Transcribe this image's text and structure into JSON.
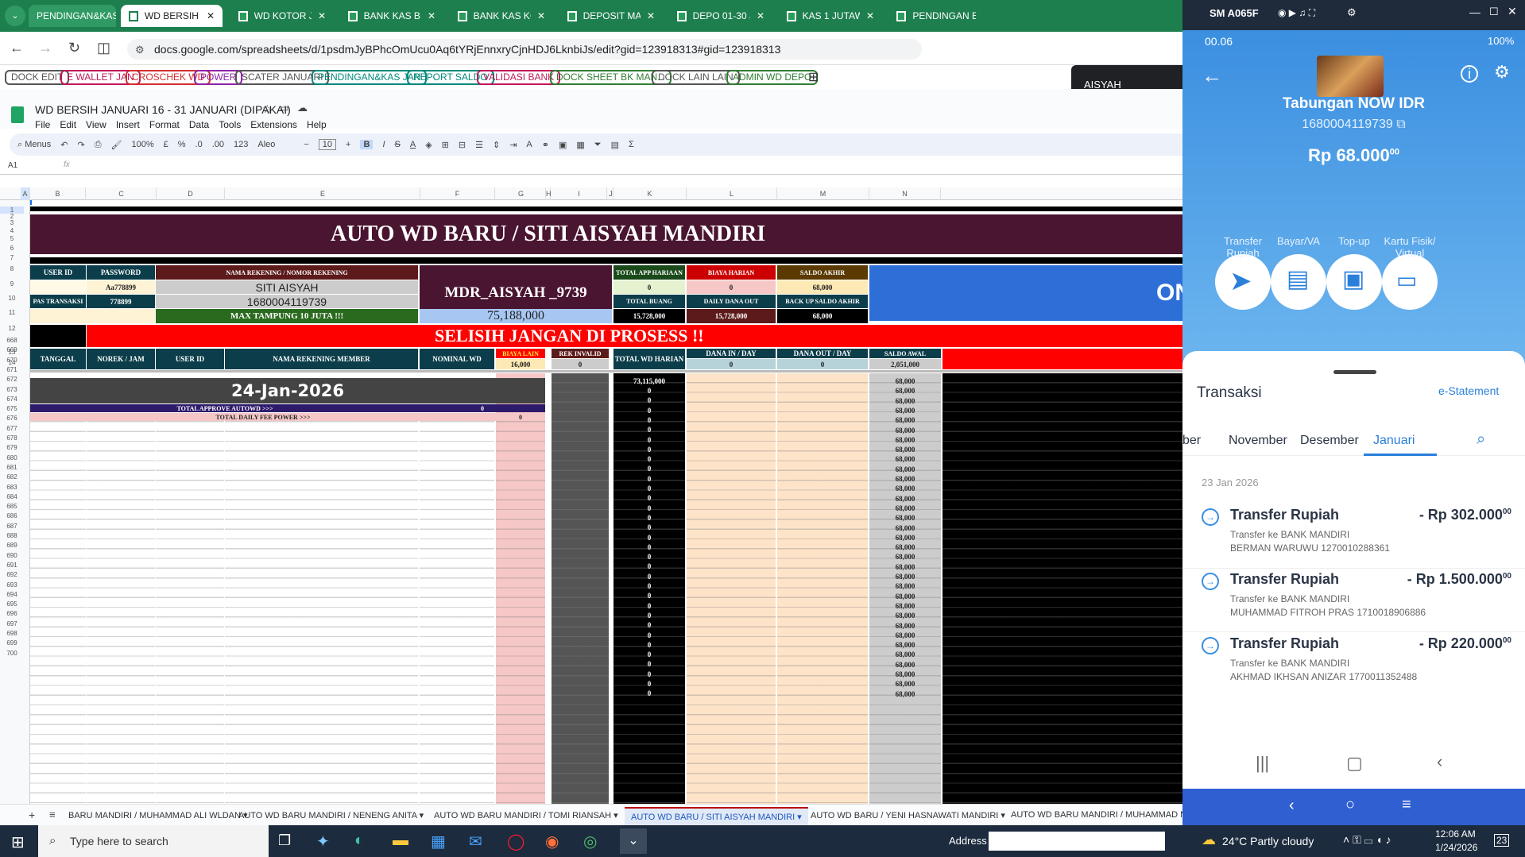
{
  "browser": {
    "tabs": [
      {
        "label": "PENDINGAN&KAS JA"
      },
      {
        "label": "WD BERSIH JANUA"
      },
      {
        "label": "WD KOTOR JANUA"
      },
      {
        "label": "BANK KAS BERSIH"
      },
      {
        "label": "BANK KAS KOTOR"
      },
      {
        "label": "DEPOSIT MANUAL"
      },
      {
        "label": "DEPO 01-30 JANU"
      },
      {
        "label": "KAS 1 JUTAWAN J"
      },
      {
        "label": "PENDINGAN EWA"
      }
    ],
    "url": "docs.google.com/spreadsheets/d/1psdmJyBPhcOmUcu0Aq6tYRjEnnxryCjnHDJ6LknbiJs/edit?gid=123918313#gid=123918313",
    "bookmarks": [
      {
        "label": "DOCK EDIT",
        "color": "#555"
      },
      {
        "label": "E WALLET JAN",
        "color": "#c2185b"
      },
      {
        "label": "CROSCHEK WD",
        "color": "#d32f2f"
      },
      {
        "label": "POWER",
        "color": "#8e24aa"
      },
      {
        "label": "SCATER JANUARI",
        "color": "#555"
      },
      {
        "label": "PENDINGAN&KAS JAN",
        "color": "#00897b"
      },
      {
        "label": "REPORT SALDO",
        "color": "#00897b"
      },
      {
        "label": "VALIDASI BANK",
        "color": "#c2185b"
      },
      {
        "label": "DOCK SHEET BK MAN...",
        "color": "#2e7d32"
      },
      {
        "label": "DOCK LAIN LAIN",
        "color": "#555"
      },
      {
        "label": "ADMIN WD DEPO",
        "color": "#2e7d32"
      }
    ],
    "popup_label": "AISYAH"
  },
  "sheet": {
    "title": "WD BERSIH JANUARI 16 - 31 JANUARI (DIPAKAI)",
    "menu": [
      "File",
      "Edit",
      "View",
      "Insert",
      "Format",
      "Data",
      "Tools",
      "Extensions",
      "Help"
    ],
    "toolbar": {
      "menus": "Menus",
      "zoom": "100%",
      "currency": "£",
      "percent": "%",
      "dec_minus": ".0",
      "dec_plus": ".00",
      "num": "123",
      "font": "Aleo",
      "font_size": "10"
    },
    "cell_ref": "A1",
    "fx": "fx",
    "columns": [
      "A",
      "B",
      "C",
      "D",
      "E",
      "F",
      "G",
      "H",
      "I",
      "J",
      "K",
      "L",
      "M",
      "N"
    ],
    "rows_top": [
      "1",
      "2",
      "3",
      "4",
      "5",
      "6",
      "7",
      "8",
      "9",
      "10",
      "11",
      "12",
      "13",
      "14"
    ],
    "rows_body": [
      "668",
      "669",
      "670",
      "671",
      "672",
      "673",
      "674",
      "675",
      "676",
      "677",
      "678",
      "679",
      "680",
      "681",
      "682",
      "683",
      "684",
      "685",
      "686",
      "687",
      "688",
      "689",
      "690",
      "691",
      "692",
      "693",
      "694",
      "695",
      "696",
      "697",
      "698",
      "699",
      "700"
    ],
    "banner": "AUTO WD BARU / SITI AISYAH MANDIRI",
    "hdr": {
      "user_id": "USER ID",
      "password": "PASSWORD",
      "nama_rek": "NAMA REKENING / NOMOR REKENING",
      "pas_transaksi": "PAS TRANSAKSI",
      "password_val": "Aa778899",
      "pas_val": "778899",
      "nama": "SITI AISYAH",
      "norek": "1680004119739",
      "max": "MAX TAMPUNG 10 JUTA !!!",
      "mdr": "MDR_AISYAH _9739",
      "mdr_total": "75,188,000",
      "total_app": "TOTAL APP HARIAAN",
      "biaya": "BIAYA HARIAN",
      "saldo_akhir": "SALDO AKHIR",
      "total_app_val": "0",
      "biaya_val": "0",
      "saldo_akhir_val": "68,000",
      "total_buang": "TOTAL BUANG",
      "daily_out": "DAILY DANA OUT",
      "backup": "BACK UP SALDO AKHIR",
      "total_buang_val": "15,728,000",
      "daily_out_val": "15,728,000",
      "backup_val": "68,000",
      "on": "ON",
      "selisih": "SELISIH JANGAN DI PROSESS !!",
      "tanggal": "TANGGAL",
      "norek_jam": "NOREK / JAM",
      "user_id2": "USER ID",
      "nama_member": "NAMA REKENING MEMBER",
      "nominal": "NOMINAL WD",
      "biaya_lain": "BIAYA LAIN",
      "biaya_lain_val": "16,000",
      "rek_invalid": "REK INVALID",
      "rek_invalid_val": "0",
      "total_wd": "TOTAL WD HARIAN",
      "dana_in": "DANA IN / DAY",
      "dana_in_val": "0",
      "dana_out": "DANA OUT / DAY",
      "dana_out_val": "0",
      "saldo_awal": "SALDO AWAL",
      "saldo_awal_val": "2,051,000"
    },
    "date_header": "24-Jan-2026",
    "total_approve": "TOTAL APPROVE AUTOWD >>>",
    "total_approve_val": "0",
    "total_fee": "TOTAL DAILY FEE POWER >>>",
    "total_fee_val": "0",
    "total_wd_first": "73,115,000",
    "k_values": [
      "0",
      "0",
      "0",
      "0",
      "0",
      "0",
      "0",
      "0",
      "0",
      "0",
      "0",
      "0",
      "0",
      "0",
      "0",
      "0",
      "0",
      "0",
      "0",
      "0",
      "0",
      "0",
      "0",
      "0",
      "0",
      "0",
      "0",
      "0",
      "0",
      "0",
      "0",
      "0"
    ],
    "n_values": [
      "68,000",
      "68,000",
      "68,000",
      "68,000",
      "68,000",
      "68,000",
      "68,000",
      "68,000",
      "68,000",
      "68,000",
      "68,000",
      "68,000",
      "68,000",
      "68,000",
      "68,000",
      "68,000",
      "68,000",
      "68,000",
      "68,000",
      "68,000",
      "68,000",
      "68,000",
      "68,000",
      "68,000",
      "68,000",
      "68,000",
      "68,000",
      "68,000",
      "68,000",
      "68,000",
      "68,000",
      "68,000",
      "68,000"
    ],
    "tabs": [
      "BARU MANDIRI / MUHAMMAD ALI WLDAN",
      "AUTO WD BARU MANDIRI / NENENG ANITA",
      "AUTO WD BARU MANDIRI / TOMI RIANSAH",
      "AUTO WD BARU / SITI AISYAH MANDIRI",
      "AUTO WD BARU / YENI HASNAWATI MANDIRI",
      "AUTO WD BARU MANDIRI / MUHAMMAD NURD"
    ]
  },
  "phone": {
    "device": "SM A065F",
    "time": "00.06",
    "battery": "100%",
    "account_name": "Tabungan NOW IDR",
    "account_no": "1680004119739",
    "balance": "Rp 68.000",
    "balance_sup": "00",
    "actions": [
      {
        "l1": "Transfer",
        "l2": "Rupiah"
      },
      {
        "l1": "Bayar/VA",
        "l2": ""
      },
      {
        "l1": "Top-up",
        "l2": ""
      },
      {
        "l1": "Kartu Fisik/",
        "l2": "Virtual"
      }
    ],
    "transaksi": "Transaksi",
    "estatement": "e-Statement",
    "months": [
      "ber",
      "November",
      "Desember",
      "Januari"
    ],
    "date": "23 Jan 2026",
    "transactions": [
      {
        "title": "Transfer Rupiah",
        "amount": "- Rp 302.000",
        "sup": "00",
        "l1": "Transfer ke BANK MANDIRI",
        "l2": "BERMAN WARUWU 1270010288361"
      },
      {
        "title": "Transfer Rupiah",
        "amount": "- Rp 1.500.000",
        "sup": "00",
        "l1": "Transfer ke BANK MANDIRI",
        "l2": "MUHAMMAD FITROH PRAS 1710018906886"
      },
      {
        "title": "Transfer Rupiah",
        "amount": "- Rp 220.000",
        "sup": "00",
        "l1": "Transfer ke BANK MANDIRI",
        "l2": "AKHMAD IKHSAN ANIZAR 1770011352488"
      }
    ]
  },
  "taskbar": {
    "search": "Type here to search",
    "address": "Address",
    "weather": "24°C  Partly cloudy",
    "time": "12:06 AM",
    "date": "1/24/2026",
    "notif": "23"
  }
}
